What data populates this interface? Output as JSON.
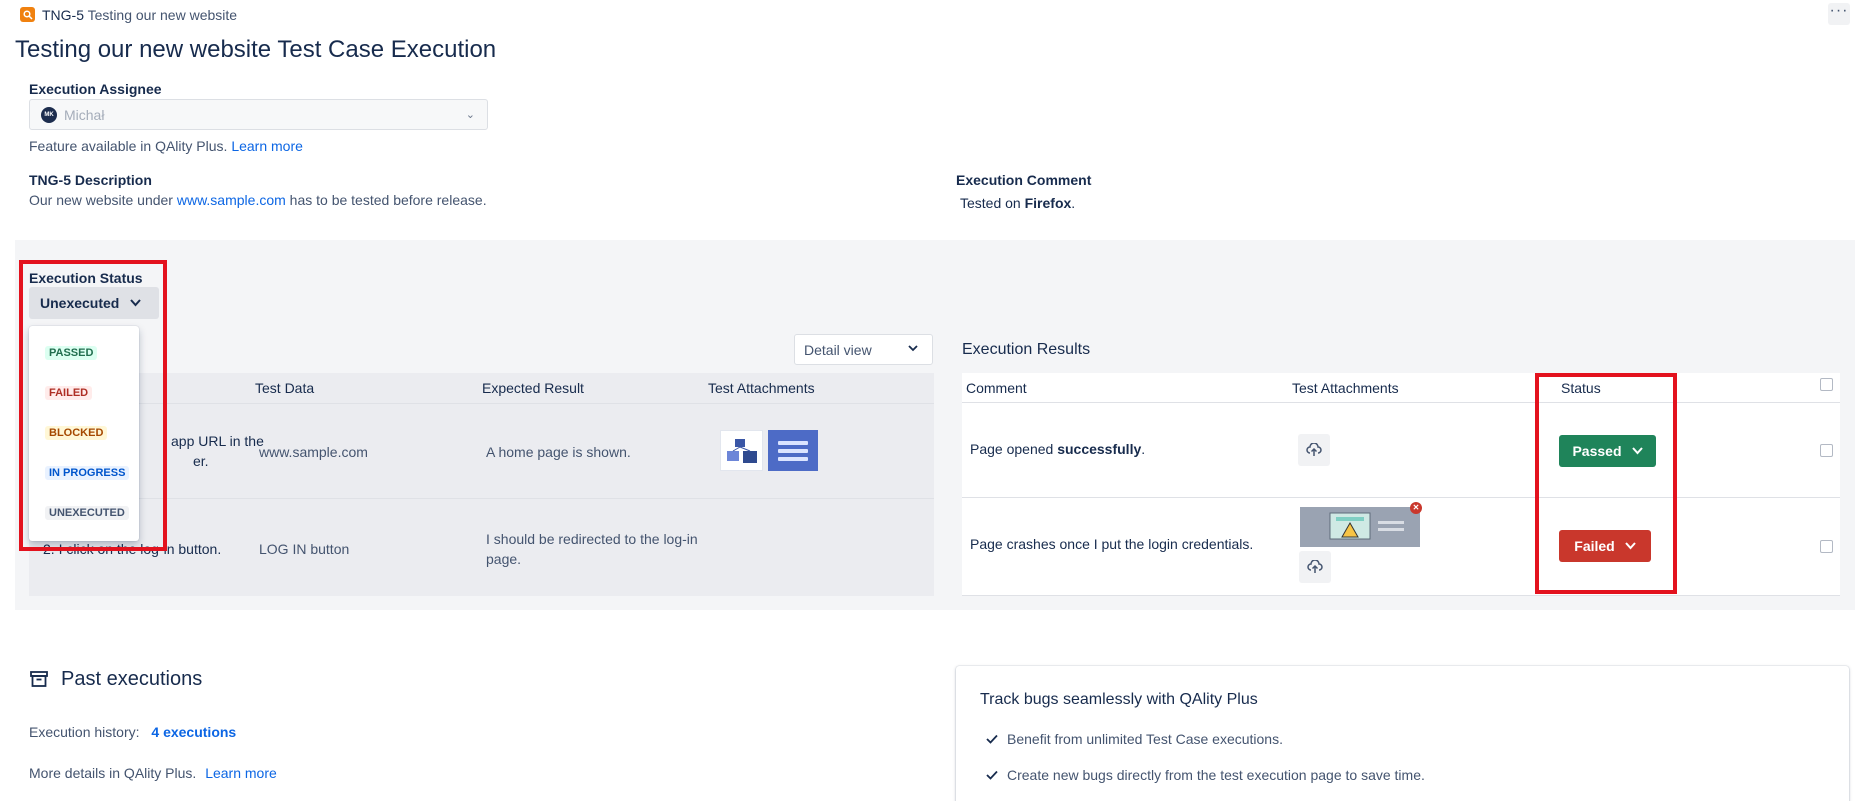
{
  "header": {
    "issue_key": "TNG-5",
    "issue_title": "Testing our new website",
    "page_title": "Testing our new website Test Case Execution",
    "more_label": "···"
  },
  "assignee": {
    "label": "Execution Assignee",
    "avatar_initials": "MK",
    "value": "Michał",
    "feature_note": "Feature available in QAlity Plus.",
    "learn_more": "Learn more"
  },
  "description": {
    "label": "TNG-5 Description",
    "text_before": "Our new website under",
    "link": "www.sample.com",
    "text_after": "has to be tested before release."
  },
  "comment": {
    "label": "Execution Comment",
    "text_before": "Tested on",
    "bold": "Firefox",
    "text_after": "."
  },
  "execution_status": {
    "label": "Execution Status",
    "value": "Unexecuted",
    "options": [
      "PASSED",
      "FAILED",
      "BLOCKED",
      "IN PROGRESS",
      "UNEXECUTED"
    ]
  },
  "steps": {
    "view_select": "Detail view",
    "columns": [
      "Test Data",
      "Expected Result",
      "Test Attachments"
    ],
    "rows": [
      {
        "action_line1": "app URL in the",
        "action_line2": "er.",
        "test_data": "www.sample.com",
        "expected": "A home page is shown."
      },
      {
        "action_line1": "2.    I click on the log-in button.",
        "test_data": "LOG IN button",
        "expected_line1": "I should be redirected to the log-in",
        "expected_line2": "page."
      }
    ]
  },
  "results": {
    "title": "Execution Results",
    "columns": [
      "Comment",
      "Test Attachments",
      "Status"
    ],
    "rows": [
      {
        "comment_before": "Page opened",
        "comment_bold": "successfully",
        "comment_after": ".",
        "status": "Passed"
      },
      {
        "comment": "Page crashes once I put the login credentials.",
        "status": "Failed"
      }
    ]
  },
  "past": {
    "title": "Past executions",
    "history_label": "Execution history:",
    "history_link": "4 executions",
    "details_text": "More details in QAlity Plus.",
    "details_link": "Learn more"
  },
  "promo": {
    "title": "Track bugs seamlessly with QAlity Plus",
    "items": [
      "Benefit from unlimited Test Case executions.",
      "Create new bugs directly from the test execution page to save time."
    ]
  },
  "colors": {
    "passed": "#1f845a",
    "failed": "#c9372c",
    "highlight_box": "#e3121e",
    "link": "#0c66e4"
  }
}
